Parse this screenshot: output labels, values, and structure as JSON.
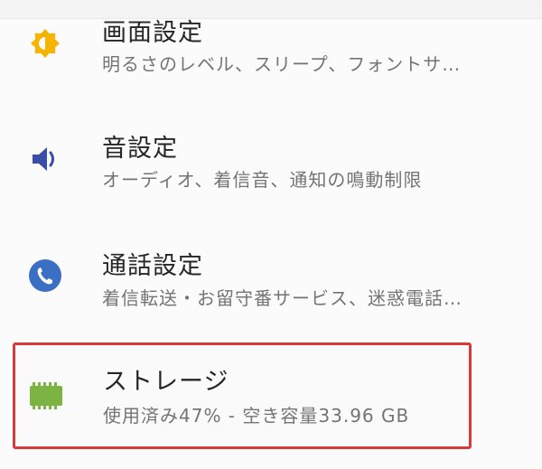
{
  "settings": {
    "items": [
      {
        "title": "画面設定",
        "subtitle": "明るさのレベル、スリープ、フォントサ…",
        "icon": "brightness-icon",
        "icon_color": "#f4b400"
      },
      {
        "title": "音設定",
        "subtitle": "オーディオ、着信音、通知の鳴動制限",
        "icon": "volume-icon",
        "icon_color": "#3a4ea8"
      },
      {
        "title": "通話設定",
        "subtitle": "着信転送・お留守番サービス、迷惑電話…",
        "icon": "phone-icon",
        "icon_color": "#3a6fc4"
      },
      {
        "title": "ストレージ",
        "subtitle": "使用済み47% - 空き容量33.96 GB",
        "icon": "storage-icon",
        "icon_color": "#7cb342",
        "highlight_color": "#d83a3a"
      }
    ]
  }
}
